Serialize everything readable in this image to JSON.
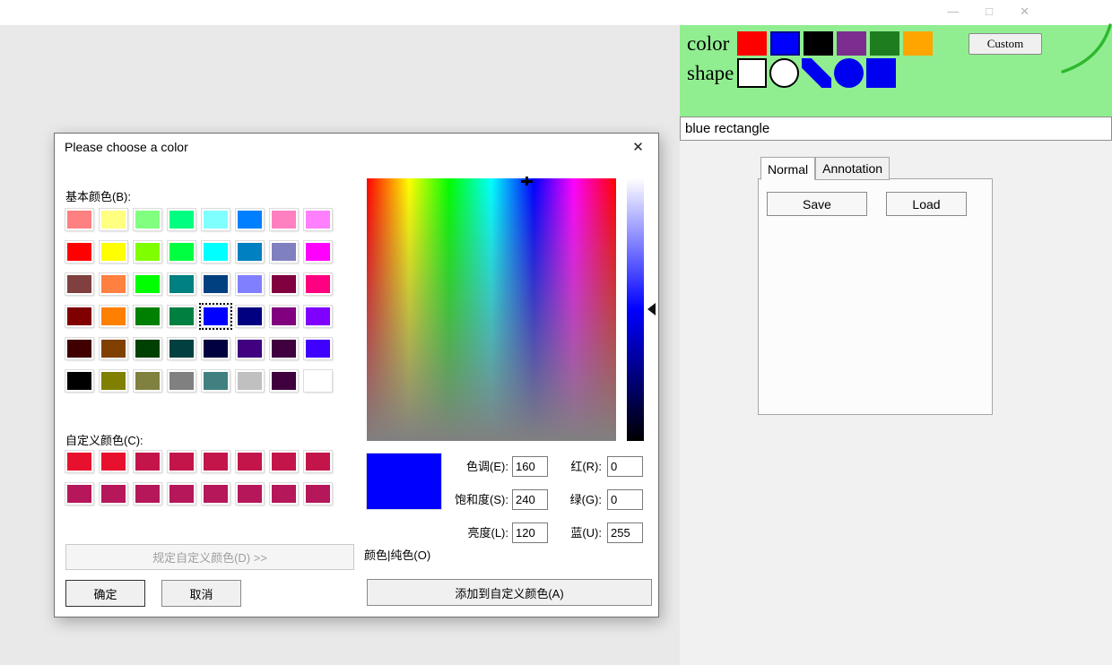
{
  "window": {
    "minimize_glyph": "—",
    "maximize_glyph": "□",
    "close_glyph": "✕"
  },
  "toolbar": {
    "panel_color": "#90ee90",
    "color_label": "color",
    "shape_label": "shape",
    "custom_button_label": "Custom",
    "colors": [
      "#ff0000",
      "#0000ff",
      "#000000",
      "#7b2d90",
      "#1e7d1e",
      "#ffa500"
    ],
    "selected_color_index": 1,
    "shapes": [
      "rect-outline",
      "circle-outline",
      "line",
      "circle-filled",
      "rect-filled"
    ],
    "annotation_stroke_color": "#2eb82e"
  },
  "status_bar": {
    "text": "blue rectangle"
  },
  "side_panel": {
    "tabs": [
      "Normal",
      "Annotation"
    ],
    "active_tab": "Normal",
    "save_button_label": "Save",
    "load_button_label": "Load"
  },
  "color_dialog": {
    "title": "Please choose a color",
    "close_glyph": "✕",
    "basic_colors_label": "基本颜色(B):",
    "basic_colors": [
      "#ff8080",
      "#ffff80",
      "#80ff80",
      "#00ff80",
      "#80ffff",
      "#0080ff",
      "#ff80c0",
      "#ff80ff",
      "#ff0000",
      "#ffff00",
      "#80ff00",
      "#00ff40",
      "#00ffff",
      "#0080c0",
      "#8080c0",
      "#ff00ff",
      "#804040",
      "#ff8040",
      "#00ff00",
      "#008080",
      "#004080",
      "#8080ff",
      "#800040",
      "#ff0080",
      "#800000",
      "#ff8000",
      "#008000",
      "#008040",
      "#0000ff",
      "#000080",
      "#800080",
      "#8000ff",
      "#400000",
      "#804000",
      "#004000",
      "#004040",
      "#000040",
      "#400080",
      "#400040",
      "#4000ff",
      "#000000",
      "#808000",
      "#808040",
      "#808080",
      "#408080",
      "#c0c0c0",
      "#400040",
      "#ffffff"
    ],
    "selected_basic_index": 28,
    "selected_basic_color": "#0000ff",
    "custom_colors_label": "自定义颜色(C):",
    "custom_colors": [
      "#e8112d",
      "#e8112d",
      "#c4154a",
      "#c4154a",
      "#c4154a",
      "#c4154a",
      "#c4154a",
      "#c4154a",
      "#b5175a",
      "#b5175a",
      "#b5175a",
      "#b5175a",
      "#b5175a",
      "#b5175a",
      "#b5175a",
      "#b5175a"
    ],
    "define_custom_label": "规定自定义颜色(D) >>",
    "ok_label": "确定",
    "cancel_label": "取消",
    "add_custom_label": "添加到自定义颜色(A)",
    "color_solid_label": "颜色|纯色(O)",
    "preview_color": "#0000ff",
    "hsl": {
      "hue_label": "色调(E):",
      "hue_value": "160",
      "sat_label": "饱和度(S):",
      "sat_value": "240",
      "lum_label": "亮度(L):",
      "lum_value": "120"
    },
    "rgb": {
      "red_label": "红(R):",
      "red_value": "0",
      "green_label": "绿(G):",
      "green_value": "0",
      "blue_label": "蓝(U):",
      "blue_value": "255"
    }
  }
}
